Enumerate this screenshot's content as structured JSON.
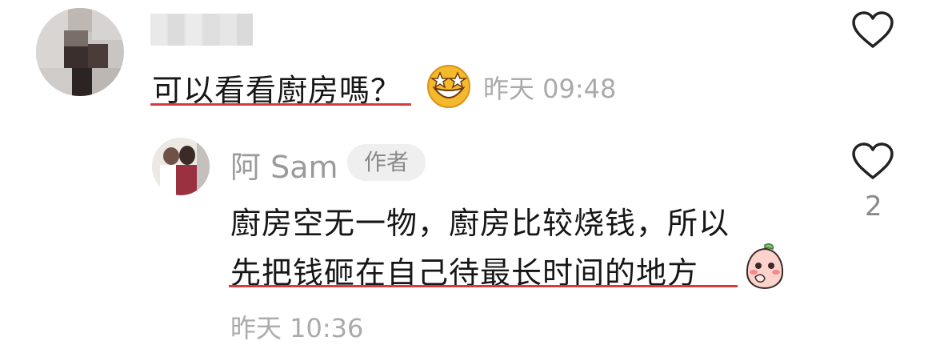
{
  "comment": {
    "text": "可以看看廚房嗎？",
    "emoji": "star-struck-emoji",
    "time": "昨天 09:48",
    "like_icon": "heart-outline-icon"
  },
  "reply": {
    "author": "阿 Sam",
    "badge": "作者",
    "line1": "廚房空无一物，廚房比较烧钱，所以",
    "line2": "先把钱砸在自己待最长时间的地方",
    "emoji": "shy-peach-emoji",
    "time": "昨天 10:36",
    "like_count": "2",
    "like_icon": "heart-outline-icon"
  },
  "colors": {
    "underline": "#d73a3a",
    "muted_text": "#aaaaaa",
    "badge_bg": "#efefef"
  }
}
